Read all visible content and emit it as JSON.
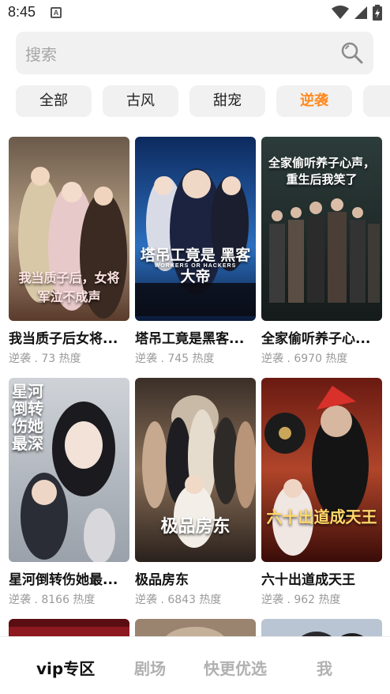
{
  "status_bar": {
    "time": "8:45",
    "notification_letter": "A",
    "icons": [
      "wifi-icon",
      "signal-icon",
      "battery-icon"
    ]
  },
  "search": {
    "placeholder": "搜索",
    "icon": "search-icon"
  },
  "tabs": [
    {
      "label": "全部",
      "active": false
    },
    {
      "label": "古风",
      "active": false
    },
    {
      "label": "甜宠",
      "active": false
    },
    {
      "label": "逆袭",
      "active": true
    }
  ],
  "cards": [
    {
      "title": "我当质子后女将...",
      "meta": "逆袭 . 73 热度",
      "poster_text": "我当质子后，女将军泣不成声"
    },
    {
      "title": "塔吊工竟是黑客...",
      "meta": "逆袭 . 745 热度",
      "poster_text": "塔吊工竟是 黑客大帝",
      "poster_subtext": "WORKERS OR HACKERS"
    },
    {
      "title": "全家偷听养子心...",
      "meta": "逆袭 . 6970 热度",
      "poster_text": "全家偷听养子心声，重生后我笑了"
    },
    {
      "title": "星河倒转伤她最...",
      "meta": "逆袭 . 8166 热度",
      "poster_text": "星河倒转伤她最深"
    },
    {
      "title": "极品房东",
      "meta": "逆袭 . 6843 热度",
      "poster_text": "极品房东"
    },
    {
      "title": "六十出道成天王",
      "meta": "逆袭 . 962 热度",
      "poster_text": "六十出道成天王"
    }
  ],
  "bottom_nav": [
    {
      "label": "vip专区",
      "active": true
    },
    {
      "label": "剧场",
      "active": false
    },
    {
      "label": "快更优选",
      "active": false
    },
    {
      "label": "我",
      "active": false
    }
  ],
  "colors": {
    "accent": "#ff8a1f",
    "chip_bg": "#f1f1f1",
    "meta_text": "#9a9a9a"
  }
}
